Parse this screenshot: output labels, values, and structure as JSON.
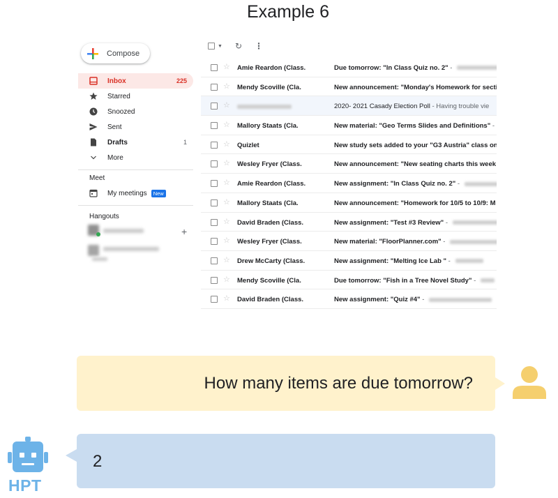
{
  "title": "Example 6",
  "gmail": {
    "compose_label": "Compose",
    "nav": [
      {
        "label": "Inbox",
        "count": "225",
        "icon": "inbox-icon"
      },
      {
        "label": "Starred",
        "count": "",
        "icon": "star-icon"
      },
      {
        "label": "Snoozed",
        "count": "",
        "icon": "clock-icon"
      },
      {
        "label": "Sent",
        "count": "",
        "icon": "send-icon"
      },
      {
        "label": "Drafts",
        "count": "1",
        "icon": "draft-icon"
      },
      {
        "label": "More",
        "count": "",
        "icon": "chevron-down-icon"
      }
    ],
    "meet_header": "Meet",
    "my_meetings": "My meetings",
    "new_badge": "New",
    "hangouts_header": "Hangouts",
    "emails": [
      {
        "sender": "Amie Reardon (Class.",
        "subject": "Due tomorrow: \"In Class Quiz no. 2\"",
        "snippet": " - ",
        "read": false
      },
      {
        "sender": "Mendy Scoville (Cla.",
        "subject": "New announcement: \"Monday's Homework for secti",
        "snippet": "",
        "read": false
      },
      {
        "sender": "",
        "subject": "2020- 2021 Casady Election Poll",
        "snippet": " - Having trouble vie",
        "read": true
      },
      {
        "sender": "Mallory Staats (Cla.",
        "subject": "New material: \"Geo Terms Slides and Definitions\"",
        "snippet": " - H",
        "read": false
      },
      {
        "sender": "Quizlet",
        "subject": "New study sets added to your \"G3 Austria\" class on",
        "snippet": "",
        "read": false
      },
      {
        "sender": "Wesley Fryer (Class.",
        "subject": "New announcement: \"New seating charts this week",
        "snippet": "",
        "read": false
      },
      {
        "sender": "Amie Reardon (Class.",
        "subject": "New assignment: \"In Class Quiz no. 2\"",
        "snippet": " - ",
        "read": false
      },
      {
        "sender": "Mallory Staats (Cla.",
        "subject": "New announcement: \"Homework for 10/5 to 10/9: M",
        "snippet": "",
        "read": false
      },
      {
        "sender": "David Braden (Class.",
        "subject": "New assignment: \"Test #3 Review\"",
        "snippet": " - ",
        "read": false
      },
      {
        "sender": "Wesley Fryer (Class.",
        "subject": "New material: \"FloorPlanner.com\"",
        "snippet": " - ",
        "read": false
      },
      {
        "sender": "Drew McCarty (Class.",
        "subject": "New assignment: \"Melting Ice Lab \"",
        "snippet": " - ",
        "read": false
      },
      {
        "sender": "Mendy Scoville (Cla.",
        "subject": "Due tomorrow: \"Fish in a Tree Novel Study\"",
        "snippet": " - ",
        "read": false
      },
      {
        "sender": "David Braden (Class.",
        "subject": "New assignment: \"Quiz #4\"",
        "snippet": " - ",
        "read": false
      }
    ]
  },
  "chat": {
    "question": "How many items are due tomorrow?",
    "answer": "2",
    "bot_label": "HPT"
  },
  "colors": {
    "question_bubble": "#fff2cc",
    "answer_bubble": "#c9dcf0",
    "user_icon": "#f5cf6e",
    "bot_icon": "#6db3e8",
    "inbox_accent": "#d93025"
  }
}
